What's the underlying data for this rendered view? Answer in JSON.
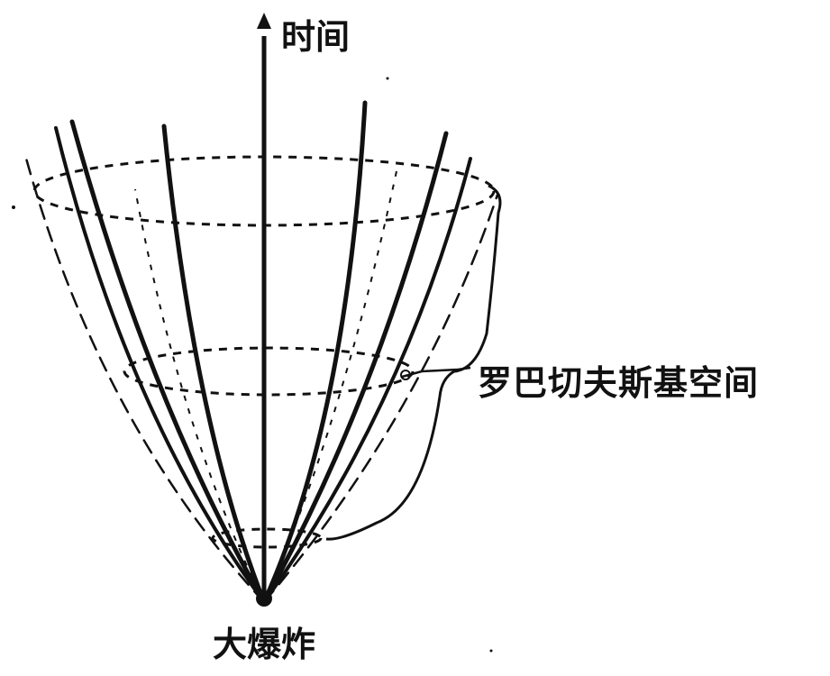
{
  "labels": {
    "time": "时间",
    "space": "罗巴切夫斯基空间",
    "big_bang": "大爆炸"
  },
  "style": {
    "ink": "#111111",
    "background": "#ffffff"
  }
}
